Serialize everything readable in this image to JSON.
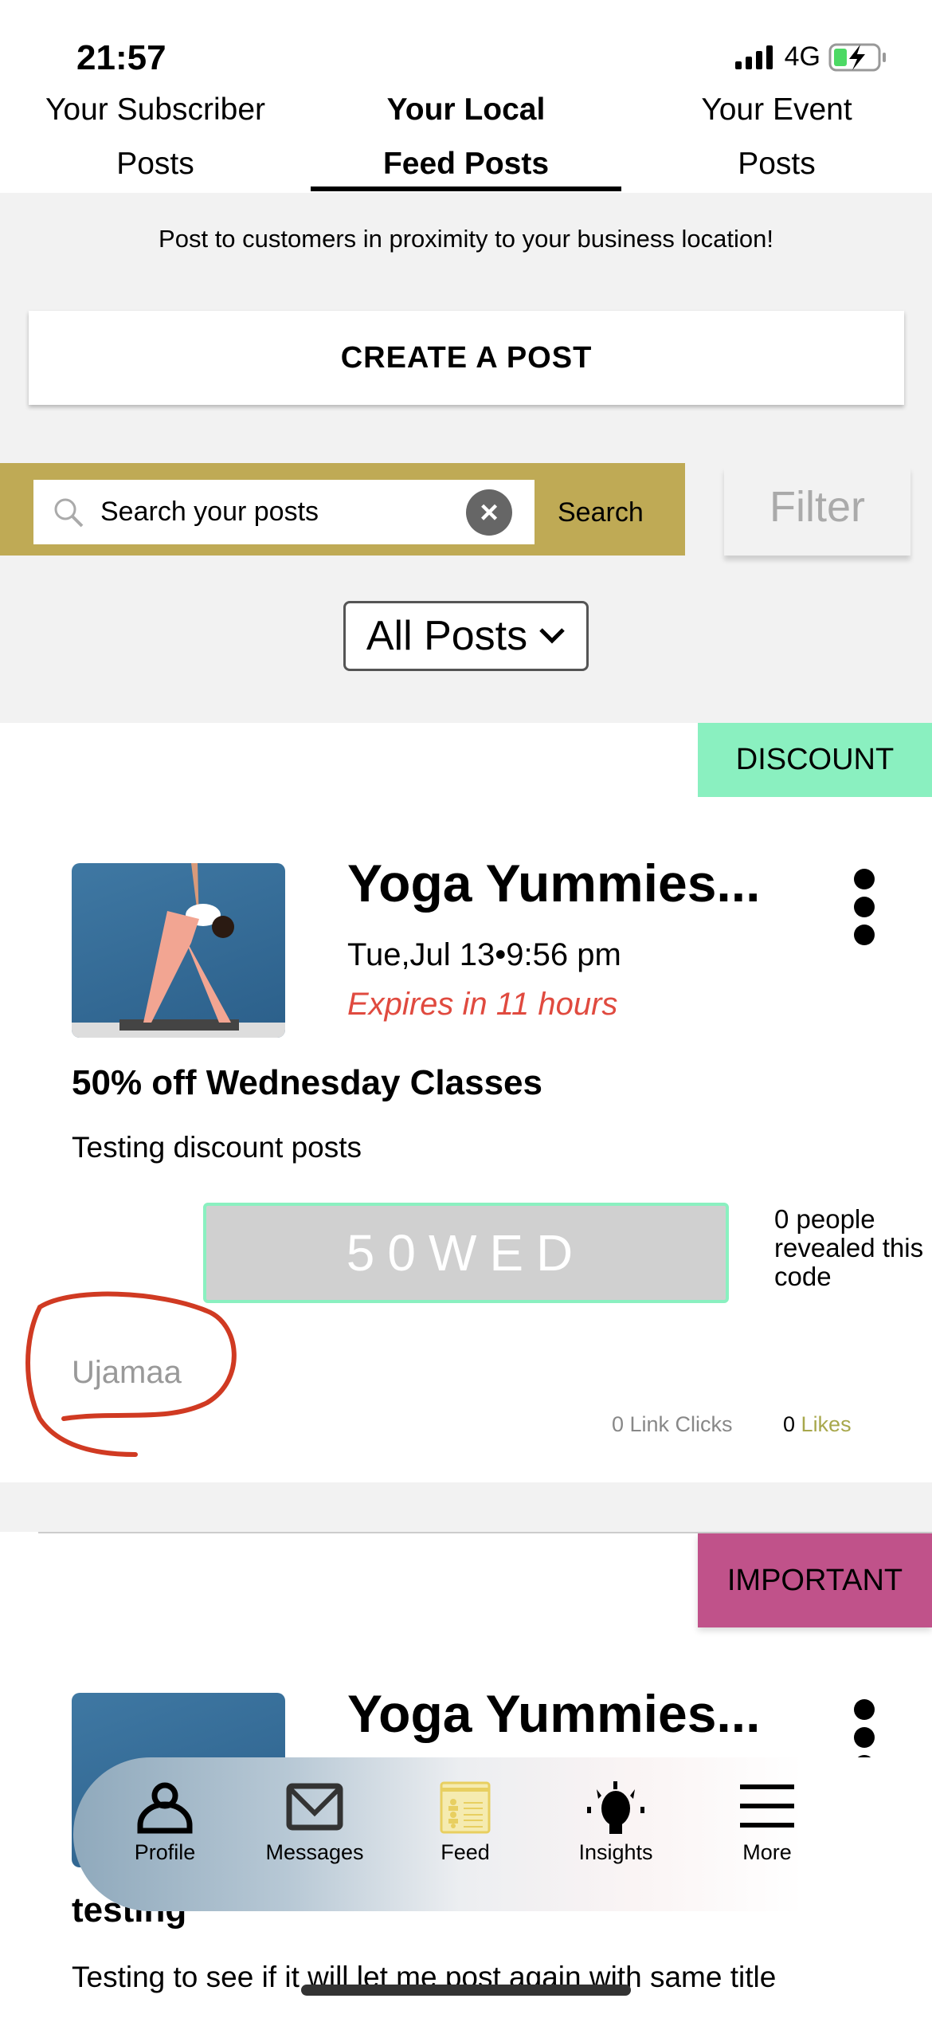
{
  "status_bar": {
    "time": "21:57",
    "network": "4G",
    "signal-icon": "signal-bars",
    "battery_icon": "battery-charging"
  },
  "tabs": [
    {
      "line1": "Your Subscriber",
      "line2": "Posts",
      "active": false
    },
    {
      "line1": "Your Local",
      "line2": "Feed Posts",
      "active": true
    },
    {
      "line1": "Your Event",
      "line2": "Posts",
      "active": false
    }
  ],
  "subtitle": "Post to customers in proximity to your business location!",
  "create_button": "CREATE A POST",
  "search": {
    "placeholder": "Search your posts",
    "value": "",
    "button": "Search",
    "accent": "#BFAA55"
  },
  "filter": "Filter",
  "post_filter": {
    "selected": "All Posts"
  },
  "posts": [
    {
      "badge": "DISCOUNT",
      "badge_color": "#8AF0C0",
      "business": "Yoga Yummies...",
      "date": "Tue,Jul 13•9:56 pm",
      "expires": "Expires in 11 hours",
      "title": "50% off Wednesday Classes",
      "description": "Testing discount posts",
      "code": "50WED",
      "revealed": "0 people revealed this code",
      "author": "Ujamaa",
      "link_clicks": "0 Link Clicks",
      "likes_count": "0",
      "likes_label": "Likes"
    },
    {
      "badge": "IMPORTANT",
      "badge_color": "#C0528A",
      "business": "Yoga Yummies...",
      "title": "testing",
      "description": "Testing to see if it will let me post again with same title"
    }
  ],
  "nav": [
    {
      "label": "Profile",
      "icon": "person-icon"
    },
    {
      "label": "Messages",
      "icon": "envelope-icon"
    },
    {
      "label": "Feed",
      "icon": "feed-icon",
      "active": true
    },
    {
      "label": "Insights",
      "icon": "lightbulb-icon"
    },
    {
      "label": "More",
      "icon": "menu-icon"
    }
  ]
}
